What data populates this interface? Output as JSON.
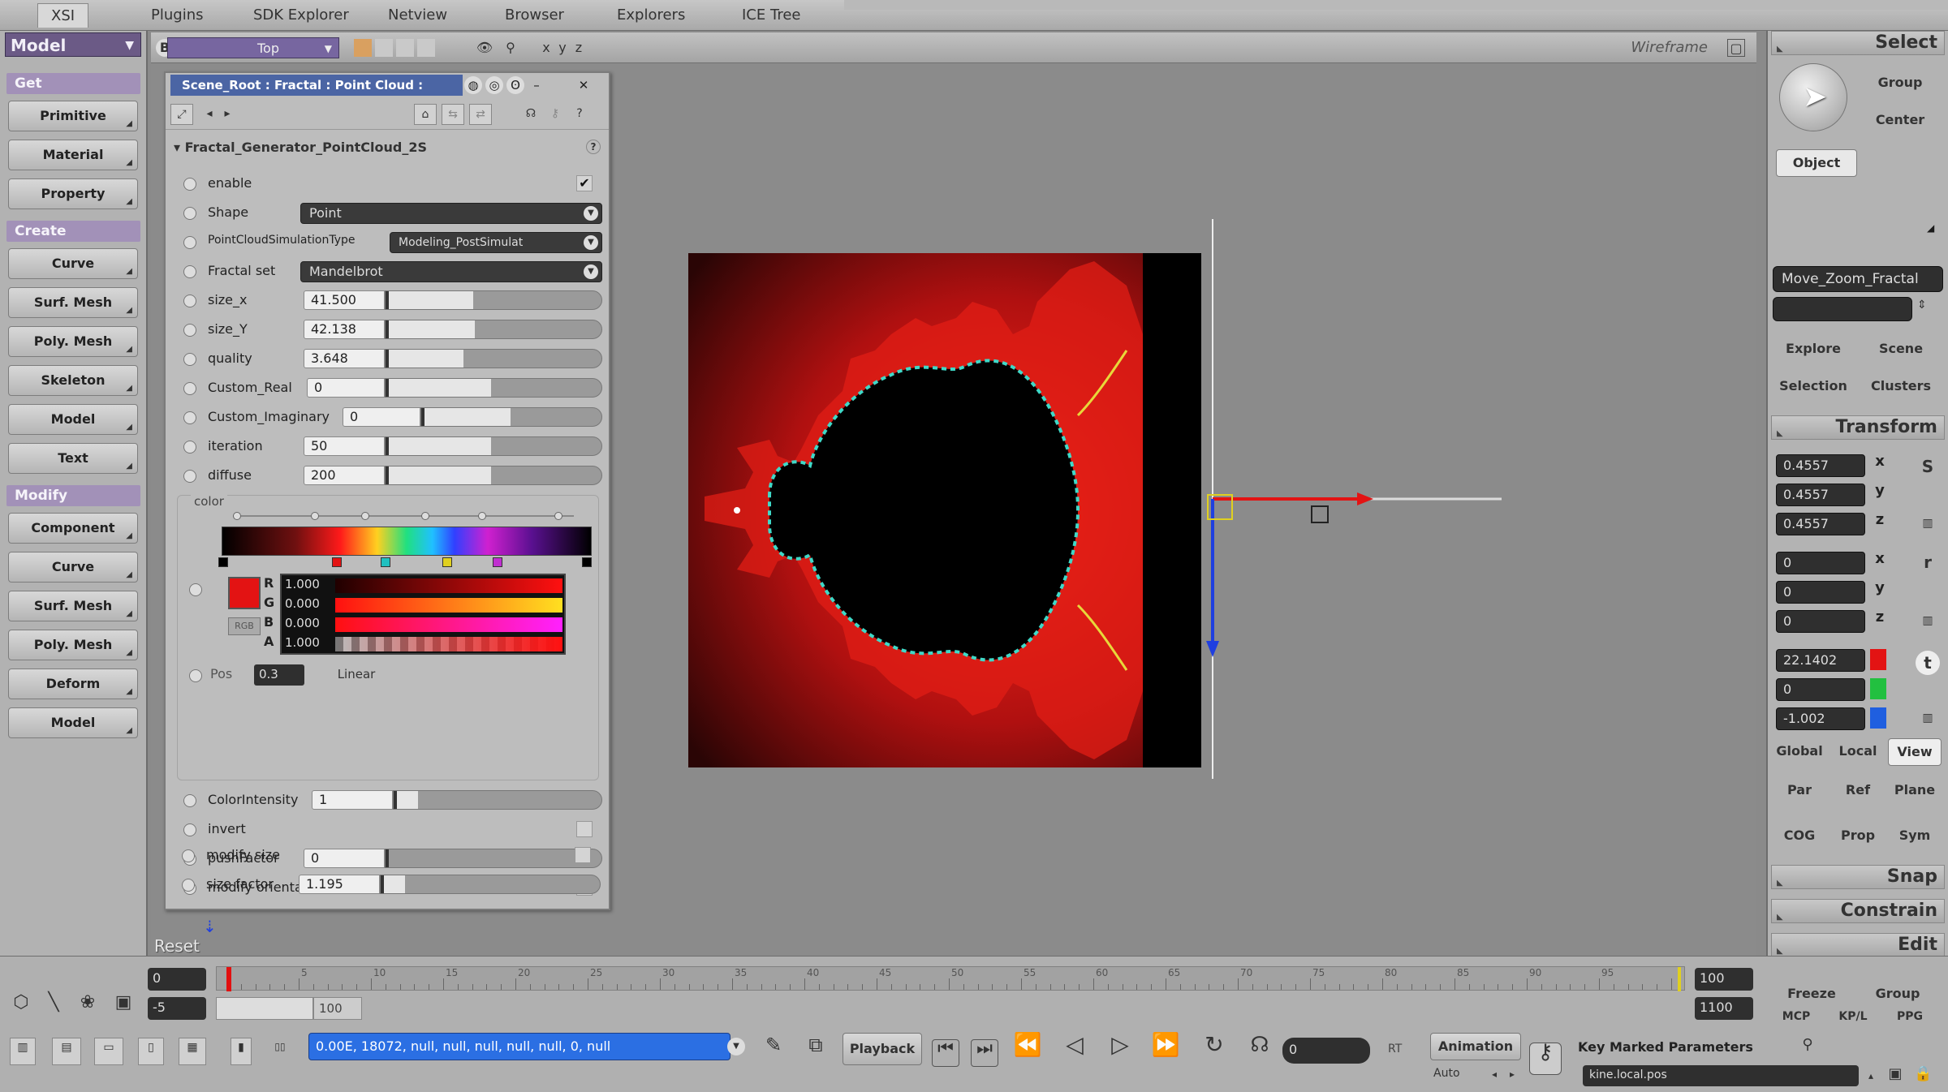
{
  "topbar": {
    "tabs": [
      "XSI",
      "Plugins",
      "SDK Explorer",
      "Netview",
      "Browser",
      "Explorers",
      "ICE Tree"
    ]
  },
  "left": {
    "mode": "Model",
    "get_header": "Get",
    "get_buttons": [
      "Primitive",
      "Material",
      "Property"
    ],
    "create_header": "Create",
    "create_buttons": [
      "Curve",
      "Surf. Mesh",
      "Poly. Mesh",
      "Skeleton",
      "Model",
      "Text"
    ],
    "modify_header": "Modify",
    "modify_buttons": [
      "Component",
      "Curve",
      "Surf. Mesh",
      "Poly. Mesh",
      "Deform",
      "Model"
    ]
  },
  "viewport": {
    "letter": "B",
    "camera": "Top",
    "display_mode": "Wireframe",
    "reset_label": "Reset"
  },
  "ppg": {
    "title": "Scene_Root : Fractal : Point Cloud :",
    "group": "Fractal_Generator_PointCloud_2S",
    "params": {
      "enable": "enable",
      "shape_label": "Shape",
      "shape_value": "Point",
      "simtype_label": "PointCloudSimulationType",
      "simtype_value": "Modeling_PostSimulat",
      "fractal_label": "Fractal set",
      "fractal_value": "Mandelbrot",
      "size_x_label": "size_x",
      "size_x_value": "41.500",
      "size_y_label": "size_Y",
      "size_y_value": "42.138",
      "quality_label": "quality",
      "quality_value": "3.648",
      "custom_real_label": "Custom_Real",
      "custom_real_value": "0",
      "custom_imag_label": "Custom_Imaginary",
      "custom_imag_value": "0",
      "iteration_label": "iteration",
      "iteration_value": "50",
      "diffuse_label": "diffuse",
      "diffuse_value": "200",
      "color_label": "color",
      "rgba_letters": [
        "R",
        "G",
        "B",
        "A"
      ],
      "rgba_values": [
        "1.000",
        "0.000",
        "0.000",
        "1.000"
      ],
      "pos_label": "Pos",
      "pos_value": "0.3",
      "interp_label": "Linear",
      "color_intensity_label": "ColorIntensity",
      "color_intensity_value": "1",
      "invert_label": "invert",
      "push_factor_label": "pushFactor",
      "push_factor_value": "0",
      "modify_orientation_label": "modify orientation",
      "modify_size_label": "modify size",
      "size_factor_label": "size factor",
      "size_factor_value": "1.195"
    }
  },
  "timeline": {
    "start": "0",
    "end": "100",
    "start2": "-5",
    "end2": "1100",
    "current": "100",
    "ticks": [
      "5",
      "10",
      "15",
      "20",
      "25",
      "30",
      "35",
      "40",
      "45",
      "50",
      "55",
      "60",
      "65",
      "70",
      "75",
      "80",
      "85",
      "90",
      "95"
    ]
  },
  "status": {
    "command": "0.00E, 18072, null, null, null, null, null, 0, null",
    "playback": "Playback",
    "frame_field": "0",
    "rt": "RT",
    "animation": "Animation",
    "auto": "Auto",
    "key_marked": "Key Marked Parameters",
    "kine": "kine.local.pos"
  },
  "right": {
    "select_header": "Select",
    "group": "Group",
    "center": "Center",
    "object": "Object",
    "selection_name": "Move_Zoom_Fractal",
    "explore": "Explore",
    "scene": "Scene",
    "selection": "Selection",
    "clusters": "Clusters",
    "transform_header": "Transform",
    "scale": [
      "0.4557",
      "0.4557",
      "0.4557"
    ],
    "rotate": [
      "0",
      "0",
      "0"
    ],
    "translate": [
      "22.1402",
      "0",
      "-1.002"
    ],
    "axis": [
      "x",
      "y",
      "z"
    ],
    "s_icon": "S",
    "r_icon": "r",
    "t_icon": "t",
    "global": "Global",
    "local": "Local",
    "view": "View",
    "par": "Par",
    "ref": "Ref",
    "plane": "Plane",
    "cog": "COG",
    "prop": "Prop",
    "sym": "Sym",
    "snap_header": "Snap",
    "constrain_header": "Constrain",
    "edit_header": "Edit",
    "freeze": "Freeze",
    "grp": "Group",
    "mcp": "MCP",
    "kp_l": "KP/L",
    "ppg": "PPG"
  },
  "colors": {
    "accent": "#6b5a86",
    "section": "#a291b8",
    "ppg_title": "#4b65a4",
    "axis_x": "#e31313",
    "axis_y": "#1f3fe0",
    "selected_field": "#2b6fe3"
  }
}
